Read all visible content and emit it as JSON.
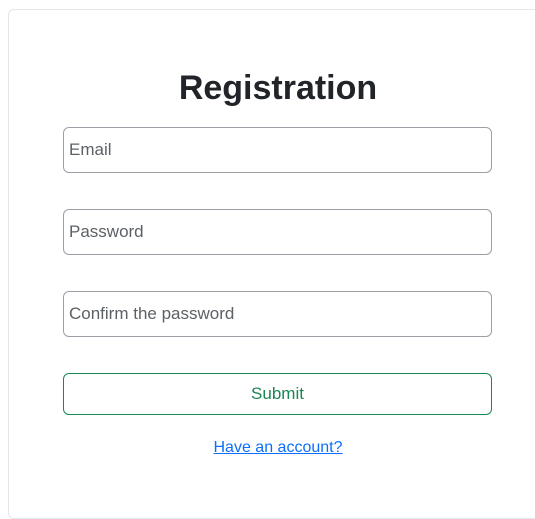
{
  "form": {
    "title": "Registration",
    "email": {
      "value": "",
      "placeholder": "Email"
    },
    "password": {
      "value": "",
      "placeholder": "Password"
    },
    "confirm_password": {
      "value": "",
      "placeholder": "Confirm the password"
    },
    "submit_label": "Submit",
    "login_link_label": "Have an account?"
  },
  "colors": {
    "submit_accent": "#198754",
    "link": "#0d6efd",
    "title_text": "#212529"
  }
}
